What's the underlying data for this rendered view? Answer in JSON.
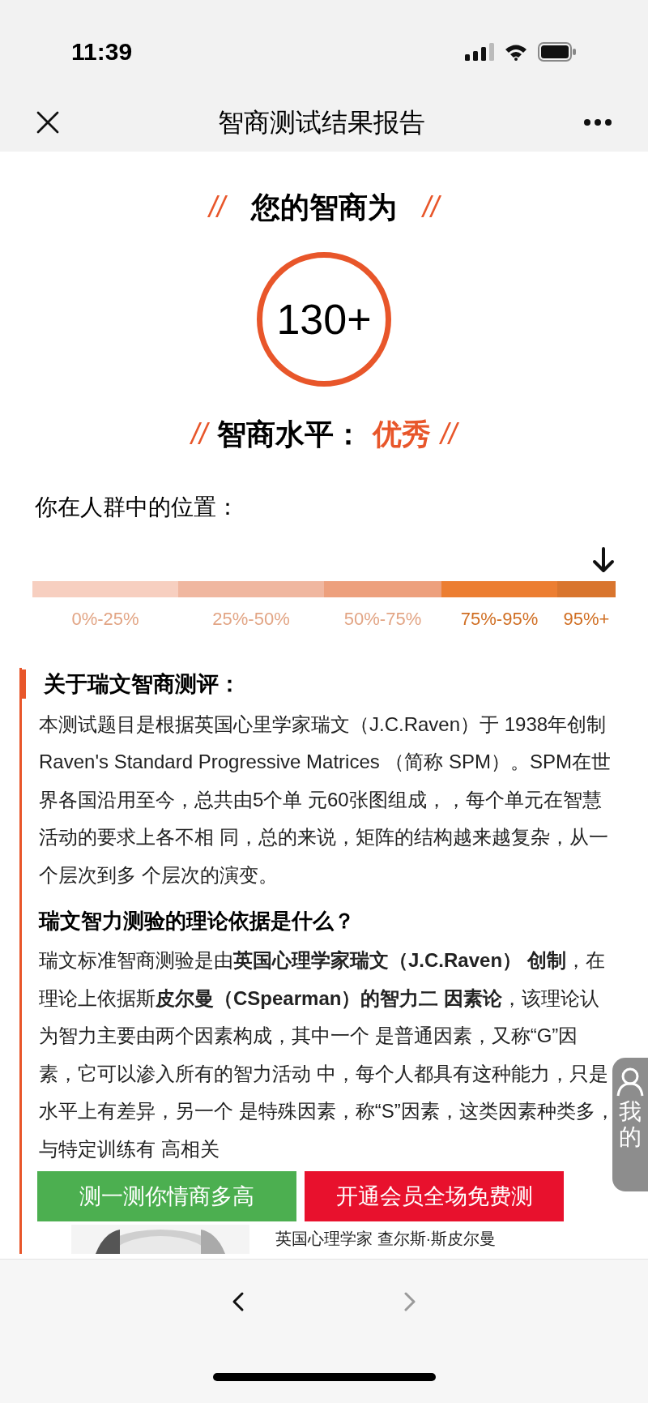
{
  "status_bar": {
    "time": "11:39"
  },
  "nav": {
    "title": "智商测试结果报告"
  },
  "score": {
    "left_mark": "//",
    "heading": "您的智商为",
    "right_mark": "//",
    "value": "130+"
  },
  "level_line": {
    "left_mark": "//",
    "label": "智商水平：",
    "value": "优秀",
    "right_mark": "//"
  },
  "position": {
    "label": "你在人群中的位置：",
    "segments": [
      {
        "label": "0%-25%",
        "color": "#f7cfc0",
        "emphasized": false,
        "selected": false
      },
      {
        "label": "25%-50%",
        "color": "#f0b7a0",
        "emphasized": false,
        "selected": false
      },
      {
        "label": "50%-75%",
        "color": "#eda07d",
        "emphasized": false,
        "selected": false
      },
      {
        "label": "75%-95%",
        "color": "#ec7e32",
        "emphasized": true,
        "selected": false
      },
      {
        "label": "95%+",
        "color": "#d9752e",
        "emphasized": true,
        "selected": true
      }
    ]
  },
  "article": {
    "sections": [
      {
        "heading": "关于瑞文智商测评：",
        "kind": "marked",
        "paragraph": "本测试题目是根据英国心里学家瑞文（J.C.Raven）于 1938年创制Raven's Standard Progressive Matrices （简称 SPM）。SPM在世界各国沿用至今，总共由5个单 元60张图组成，，每个单元在智慧活动的要求上各不相 同，总的来说，矩阵的结构越来越复杂，从一个层次到多 个层次的演变。"
      },
      {
        "heading": "瑞文智力测验的理论依据是什么？",
        "kind": "plain",
        "paragraph": "瑞文标准智商测验是由**英国心理学家瑞文（J.C.Raven） 创制**，在理论上依据斯**皮尔曼（CSpearman）的智力二 因素论**，该理论认为智力主要由两个因素构成，其中一个 是普通因素，又称“G”因素，它可以渗入所有的智力活动 中，每个人都具有这种能力，只是水平上有差异，另一个 是特殊因素，称“S”因素，这类因素种类多，与特定训练有 高相关"
      }
    ],
    "figure": {
      "kind": "picture",
      "caption": "英国心理学家 查尔斯·斯皮尔曼"
    }
  },
  "actions": [
    {
      "label": "测一测你情商多高",
      "color": "#4caf50"
    },
    {
      "label": "开通会员全场免费测",
      "color": "#e8112d"
    }
  ],
  "side_tab": {
    "label": "我的"
  },
  "bottom_bar": [
    {
      "kind": "back",
      "disabled": false
    },
    {
      "kind": "forward",
      "disabled": true
    }
  ]
}
